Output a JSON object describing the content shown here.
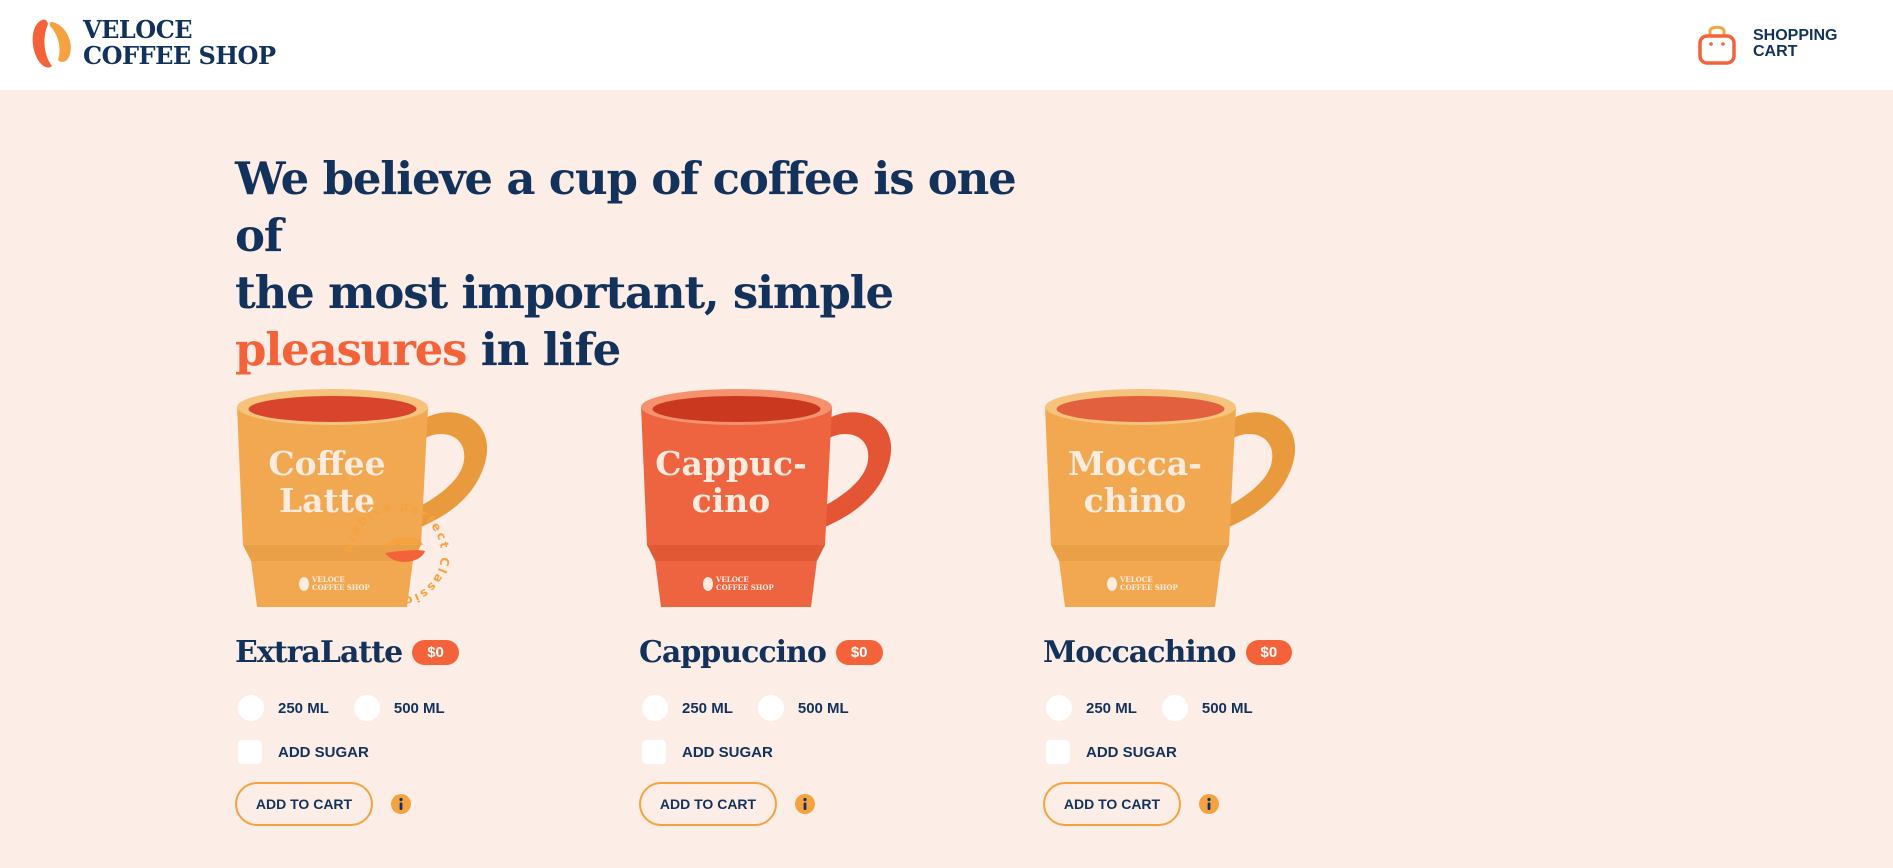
{
  "header": {
    "logo_line1": "VELOCE",
    "logo_line2": "COFFEE SHOP",
    "logo_icon": "coffee-bean-icon",
    "cart_line1": "SHOPPING",
    "cart_line2": "CART",
    "cart_icon": "shopping-bag-icon"
  },
  "hero": {
    "line1": "We believe a cup of coffee is one of",
    "line2": "the most important, simple",
    "accent": "pleasures",
    "rest": " in life"
  },
  "colors": {
    "navy": "#13325b",
    "accent": "#f4623a",
    "orange": "#f4a340",
    "background": "#fcede6"
  },
  "products": [
    {
      "name": "ExtraLatte",
      "price": "$0",
      "mug_color": "#f1a850",
      "mug_text_line1": "Coffee",
      "mug_text_line2": "Latte",
      "mug_brand_line1": "VELOCE",
      "mug_brand_line2": "COFFEE SHOP",
      "stamp_text": "Arabica perfect Classic",
      "sizes": [
        "250 ML",
        "500 ML"
      ],
      "sugar_label": "ADD SUGAR",
      "button_label": "ADD TO CART",
      "info_icon": "info-icon"
    },
    {
      "name": "Cappuccino",
      "price": "$0",
      "mug_color": "#ee6440",
      "mug_text_line1": "Cappuc-",
      "mug_text_line2": "cino",
      "mug_brand_line1": "VELOCE",
      "mug_brand_line2": "COFFEE SHOP",
      "sizes": [
        "250 ML",
        "500 ML"
      ],
      "sugar_label": "ADD SUGAR",
      "button_label": "ADD TO CART",
      "info_icon": "info-icon"
    },
    {
      "name": "Moccachino",
      "price": "$0",
      "mug_color": "#f1a850",
      "mug_text_line1": "Mocca-",
      "mug_text_line2": "chino",
      "mug_brand_line1": "VELOCE",
      "mug_brand_line2": "COFFEE SHOP",
      "sizes": [
        "250 ML",
        "500 ML"
      ],
      "sugar_label": "ADD SUGAR",
      "button_label": "ADD TO CART",
      "info_icon": "info-icon"
    }
  ]
}
